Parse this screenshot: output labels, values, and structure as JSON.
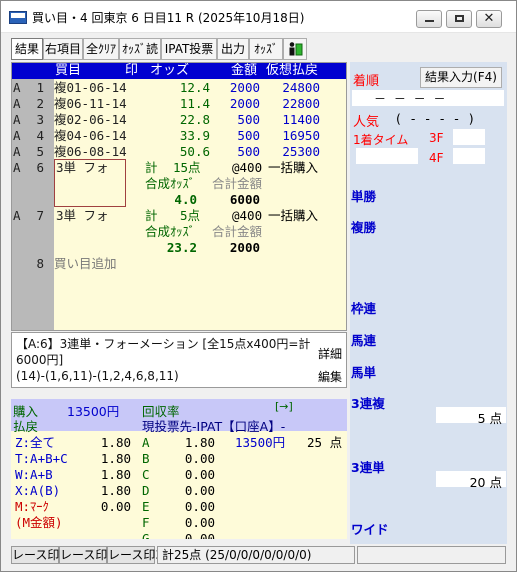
{
  "window": {
    "title": "買い目・4 回東京 6 日目11 R (2025年10月18日)",
    "icon_label": "PREM"
  },
  "toolbar": [
    "結果",
    "右項目",
    "全ｸﾘｱ",
    "ｵｯｽﾞ読",
    "IPAT投票",
    "出力",
    "ｵｯｽﾞ"
  ],
  "betlist": {
    "headers": {
      "kaime": "買目",
      "mark": "印",
      "odds": "オッズ",
      "amount": "金額",
      "payout": "仮想払戻"
    },
    "rows": [
      {
        "grp": "A",
        "no": "1",
        "kind": "複01-06-14",
        "odds": "12.4",
        "amount": "2000",
        "payout": "24800"
      },
      {
        "grp": "A",
        "no": "2",
        "kind": "複06-11-14",
        "odds": "11.4",
        "amount": "2000",
        "payout": "22800"
      },
      {
        "grp": "A",
        "no": "3",
        "kind": "複02-06-14",
        "odds": "22.8",
        "amount": "500",
        "payout": "11400"
      },
      {
        "grp": "A",
        "no": "4",
        "kind": "複04-06-14",
        "odds": "33.9",
        "amount": "500",
        "payout": "16950"
      },
      {
        "grp": "A",
        "no": "5",
        "kind": "複06-08-14",
        "odds": "50.6",
        "amount": "500",
        "payout": "25300"
      }
    ],
    "formations": [
      {
        "grp": "A",
        "no": "6",
        "kind": "3単 フォ",
        "total_label": "計",
        "count": "15点",
        "unit": "@400",
        "mode": "一括購入",
        "synth_label": "合成ｵｯｽﾞ",
        "sum_label": "合計金額",
        "synth": "4.0",
        "sum": "6000"
      },
      {
        "grp": "A",
        "no": "7",
        "kind": "3単 フォ",
        "total_label": "計",
        "count": "5点",
        "unit": "@400",
        "mode": "一括購入",
        "synth_label": "合成ｵｯｽﾞ",
        "sum_label": "合計金額",
        "synth": "23.2",
        "sum": "2000"
      }
    ],
    "add_row": {
      "no": "8",
      "label": "買い目追加"
    }
  },
  "description": {
    "text": "【A:6】3連単・フォーメーション [全15点x400円=計6000円]",
    "formula": "(14)-(1,6,11)-(1,2,4,6,8,11)",
    "detail_button": "詳細",
    "edit_button": "編集"
  },
  "summary": {
    "purchase_label": "購入",
    "purchase_value": "13500円",
    "recovery_label": "回収率",
    "arrow": "[→]",
    "payout_label": "払戻",
    "destination": "現投票先-IPAT【口座A】-",
    "rows": [
      {
        "label": "Z:全て",
        "value": "1.80",
        "cat": "A",
        "payout": "1.80",
        "extra1": "13500円",
        "extra2": "25 点"
      },
      {
        "label": "T:A+B+C",
        "value": "1.80",
        "cat": "B",
        "payout": "0.00"
      },
      {
        "label": "W:A+B",
        "value": "1.80",
        "cat": "C",
        "payout": "0.00"
      },
      {
        "label": "X:A(B)",
        "value": "1.80",
        "cat": "D",
        "payout": "0.00"
      },
      {
        "label": "M:ﾏｰｸ",
        "value": "0.00",
        "cat": "E",
        "payout": "0.00"
      },
      {
        "label": "(M金額)",
        "value": "",
        "cat": "F",
        "payout": "0.00"
      },
      {
        "label": "",
        "value": "",
        "cat": "G",
        "payout": "0.00"
      }
    ]
  },
  "statusbar": {
    "tabs": [
      "レース印1",
      "レース印2",
      "レース印3"
    ],
    "count_text": "計25点 (25/0/0/0/0/0/0/0)"
  },
  "rightpanel": {
    "order_label": "着順",
    "result_button": "結果入力(F4)",
    "order_dashes": "－  －  －  －",
    "popularity_label": "人気",
    "popularity_values": "(  -  -  -  -  )",
    "first_time_label": "1着タイム",
    "f3": "3F",
    "f4": "4F",
    "sections": [
      "単勝",
      "複勝",
      "枠連",
      "馬連",
      "馬単",
      "3連複",
      "3連単",
      "ワイド"
    ],
    "sanrenpuku_points": "5 点",
    "sanrentan_points": "20 点"
  }
}
